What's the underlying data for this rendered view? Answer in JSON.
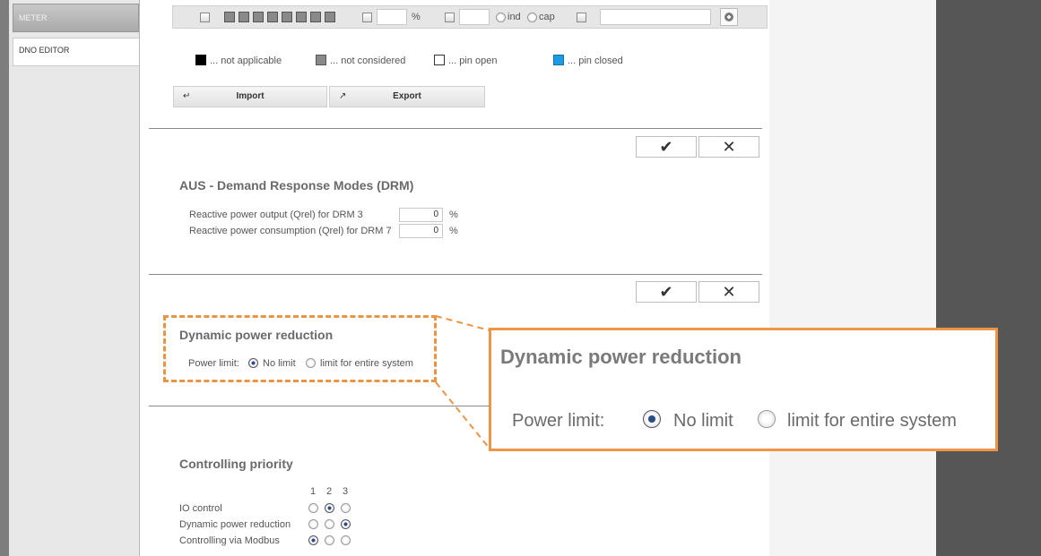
{
  "sidebar": {
    "items": [
      {
        "label": "METER",
        "active": false
      },
      {
        "label": "DNO EDITOR",
        "active": true
      }
    ]
  },
  "toolbar": {
    "percent_symbol": "%",
    "ind_label": "ind",
    "cap_label": "cap"
  },
  "legend": {
    "not_applicable": "... not applicable",
    "not_considered": "... not considered",
    "pin_open": "... pin open",
    "pin_closed": "... pin closed",
    "colors": {
      "not_applicable": "#000000",
      "not_considered": "#8a8a8a",
      "pin_open": "#ffffff",
      "pin_closed": "#1a9be3"
    }
  },
  "actions": {
    "import_label": "Import",
    "export_label": "Export"
  },
  "confirm": {
    "ok_symbol": "✔",
    "cancel_symbol": "✕"
  },
  "drm": {
    "title": "AUS - Demand Response Modes (DRM)",
    "rows": [
      {
        "label": "Reactive power output (Qrel) for DRM 3",
        "value": "0",
        "unit": "%"
      },
      {
        "label": "Reactive power consumption (Qrel) for DRM 7",
        "value": "0",
        "unit": "%"
      }
    ]
  },
  "dynamic": {
    "title": "Dynamic power reduction",
    "power_limit_label": "Power limit:",
    "option_no_limit": "No limit",
    "option_entire_system": "limit for entire system",
    "selected": "No limit"
  },
  "priority": {
    "title": "Controlling priority",
    "columns": [
      "1",
      "2",
      "3"
    ],
    "rows": [
      {
        "label": "IO control",
        "selected": 2
      },
      {
        "label": "Dynamic power reduction",
        "selected": 3
      },
      {
        "label": "Controlling via Modbus",
        "selected": 1
      }
    ]
  },
  "colors": {
    "accent_orange": "#ee9647",
    "pin_closed_blue": "#1a9be3"
  }
}
